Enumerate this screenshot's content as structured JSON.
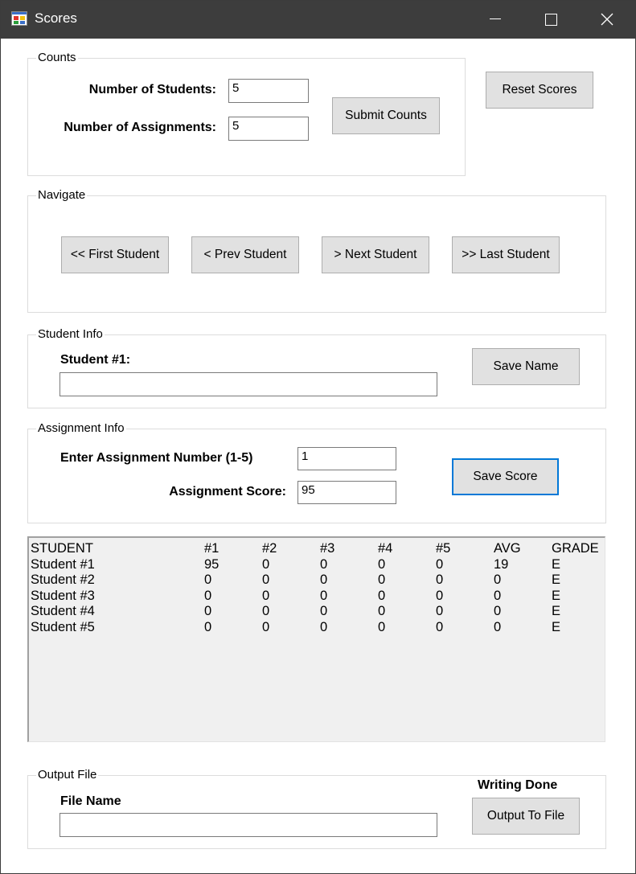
{
  "window": {
    "title": "Scores"
  },
  "counts": {
    "group_label": "Counts",
    "students_label": "Number of Students:",
    "students_value": "5",
    "assignments_label": "Number of Assignments:",
    "assignments_value": "5",
    "submit_label": "Submit Counts"
  },
  "reset_label": "Reset Scores",
  "navigate": {
    "group_label": "Navigate",
    "first": "<< First Student",
    "prev": "< Prev Student",
    "next": "> Next Student",
    "last": ">> Last Student"
  },
  "student_info": {
    "group_label": "Student Info",
    "student_label": "Student #1:",
    "name_value": "",
    "save_label": "Save Name"
  },
  "assignment_info": {
    "group_label": "Assignment Info",
    "number_label": "Enter Assignment Number (1-5)",
    "number_value": "1",
    "score_label": "Assignment Score:",
    "score_value": "95",
    "save_label": "Save Score"
  },
  "score_table": {
    "headers": [
      "STUDENT",
      "#1",
      "#2",
      "#3",
      "#4",
      "#5",
      "AVG",
      "GRADE"
    ],
    "rows": [
      [
        "Student #1",
        "95",
        "0",
        "0",
        "0",
        "0",
        "19",
        "E"
      ],
      [
        "Student #2",
        "0",
        "0",
        "0",
        "0",
        "0",
        "0",
        "E"
      ],
      [
        "Student #3",
        "0",
        "0",
        "0",
        "0",
        "0",
        "0",
        "E"
      ],
      [
        "Student #4",
        "0",
        "0",
        "0",
        "0",
        "0",
        "0",
        "E"
      ],
      [
        "Student #5",
        "0",
        "0",
        "0",
        "0",
        "0",
        "0",
        "E"
      ]
    ]
  },
  "output": {
    "group_label": "Output File",
    "file_name_label": "File Name",
    "file_name_value": "",
    "status": "Writing Done",
    "output_label": "Output To File"
  },
  "icons": {
    "app": "app-window-icon",
    "minimize": "minimize-icon",
    "maximize": "maximize-icon",
    "close": "close-icon"
  },
  "colors": {
    "titlebar": "#3d3d3d",
    "button_face": "#e1e1e1",
    "focus_border": "#0078d7",
    "listbox_bg": "#f0f0f0"
  }
}
